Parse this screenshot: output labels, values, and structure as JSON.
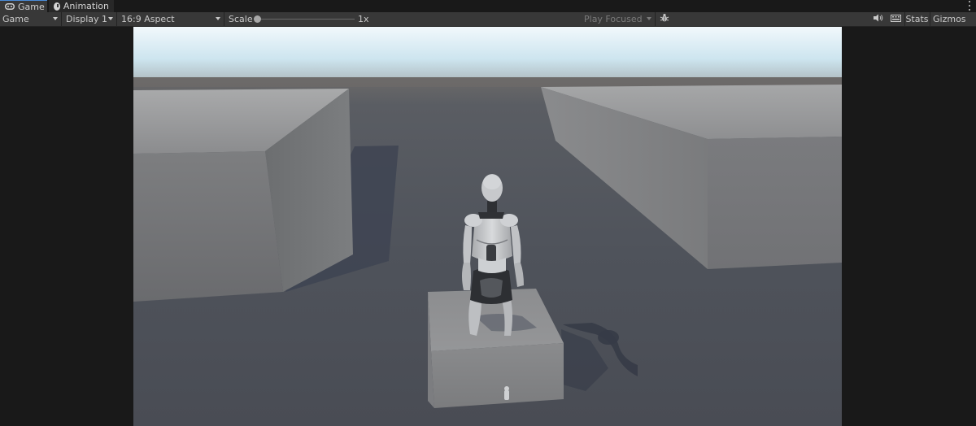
{
  "tabs": [
    {
      "label": "Game",
      "icon": "gamepad-icon",
      "active": true
    },
    {
      "label": "Animation",
      "icon": "clock-icon",
      "active": false
    }
  ],
  "toolbar": {
    "view_mode": "Game",
    "display": "Display 1",
    "aspect": "16:9 Aspect",
    "scale_label": "Scale",
    "scale_value": "1x",
    "play_mode": "Play Focused",
    "stats_label": "Stats",
    "gizmos_label": "Gizmos"
  },
  "icons": {
    "more": "kebab-menu-icon",
    "bug": "bug-icon",
    "mute": "speaker-icon",
    "keyboard": "keyboard-icon"
  },
  "colors": {
    "accent": "#4a8cd8",
    "toolbar_bg": "#383838",
    "panel_bg": "#191919",
    "sky_top": "#eef6fb",
    "sky_horizon": "#c9e3ee",
    "ground": "#4c4f57"
  }
}
